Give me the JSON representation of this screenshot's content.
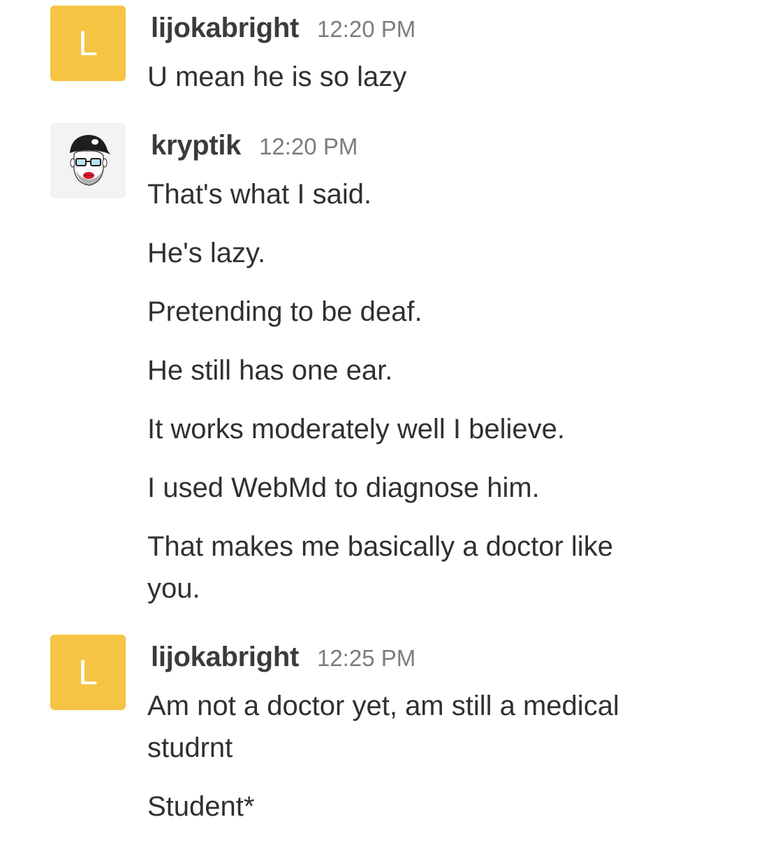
{
  "messages": [
    {
      "user": "lijokabright",
      "avatar_letter": "L",
      "time": "12:20 PM",
      "lines": [
        "U mean he is so lazy"
      ]
    },
    {
      "user": "kryptik",
      "avatar_icon": "bearded-man-cap-avatar",
      "time": "12:20 PM",
      "lines": [
        "That's what I said.",
        "He's lazy.",
        "Pretending to be deaf.",
        "He still has one ear.",
        "It works moderately well I believe.",
        "I used WebMd to diagnose him.",
        "That makes me basically a doctor like",
        "you."
      ]
    },
    {
      "user": "lijokabright",
      "avatar_letter": "L",
      "time": "12:25 PM",
      "lines": [
        "Am not a doctor yet, am still a medical",
        "studrnt",
        "Student*"
      ]
    }
  ],
  "colors": {
    "avatar_bg": "#f5c443",
    "username": "#3a3b3e",
    "timestamp": "#7a7c80",
    "text": "#2f3034"
  }
}
